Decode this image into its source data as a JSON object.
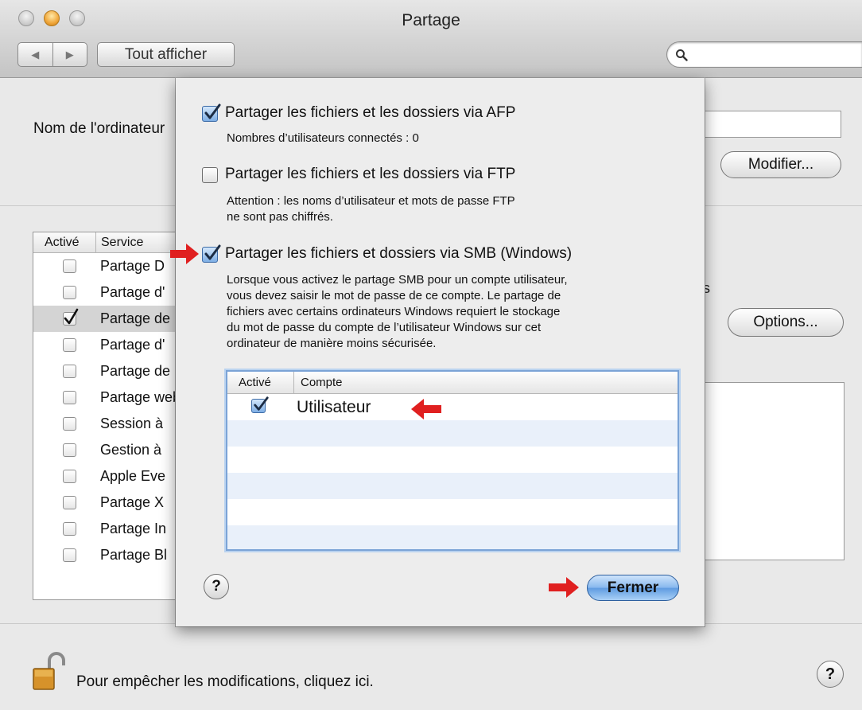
{
  "window": {
    "title": "Partage",
    "nav_back": "◀",
    "nav_forward": "▶",
    "show_all": "Tout afficher",
    "search": {
      "value": "",
      "placeholder": ""
    }
  },
  "pane": {
    "computer_name_label": "Nom de l'ordinateur",
    "modifier_button": "Modifier...",
    "services_header": {
      "enabled": "Activé",
      "service": "Service"
    },
    "services": [
      {
        "name": "Partage D",
        "checked": false
      },
      {
        "name": "Partage d'",
        "checked": false
      },
      {
        "name": "Partage de",
        "checked": true
      },
      {
        "name": "Partage d'",
        "checked": false
      },
      {
        "name": "Partage de",
        "checked": false
      },
      {
        "name": "Partage web",
        "checked": false
      },
      {
        "name": "Session à",
        "checked": false
      },
      {
        "name": "Gestion à",
        "checked": false
      },
      {
        "name": "Apple Eve",
        "checked": false
      },
      {
        "name": "Partage X",
        "checked": false
      },
      {
        "name": "Partage In",
        "checked": false
      },
      {
        "name": "Partage Bl",
        "checked": false
      }
    ],
    "options_button": "Options...",
    "right_fragment": "s",
    "lock_text": "Pour empêcher les modifications, cliquez ici.",
    "help": "?"
  },
  "sheet": {
    "afp": {
      "label": "Partager les fichiers et les dossiers via AFP",
      "checked": true,
      "sub": "Nombres d’utilisateurs connectés : 0"
    },
    "ftp": {
      "label": "Partager les fichiers et les dossiers via FTP",
      "checked": false,
      "sub_line1": "Attention : les noms d’utilisateur et mots de passe FTP",
      "sub_line2": "ne sont pas chiffrés."
    },
    "smb": {
      "label": "Partager les fichiers et dossiers via SMB (Windows)",
      "checked": true,
      "desc_lines": [
        "Lorsque vous activez le partage SMB pour un compte utilisateur,",
        "vous devez saisir le mot de passe de ce compte. Le partage de",
        "fichiers avec certains ordinateurs Windows requiert le stockage",
        "du mot de passe du compte de l’utilisateur Windows sur cet",
        "ordinateur de manière moins sécurisée."
      ]
    },
    "accounts_header": {
      "enabled": "Activé",
      "account": "Compte"
    },
    "accounts": [
      {
        "name": "Utilisateur",
        "checked": true
      }
    ],
    "help": "?",
    "close_button": "Fermer"
  },
  "colors": {
    "arrow": "#e02020",
    "accent": "#5e9be0"
  }
}
